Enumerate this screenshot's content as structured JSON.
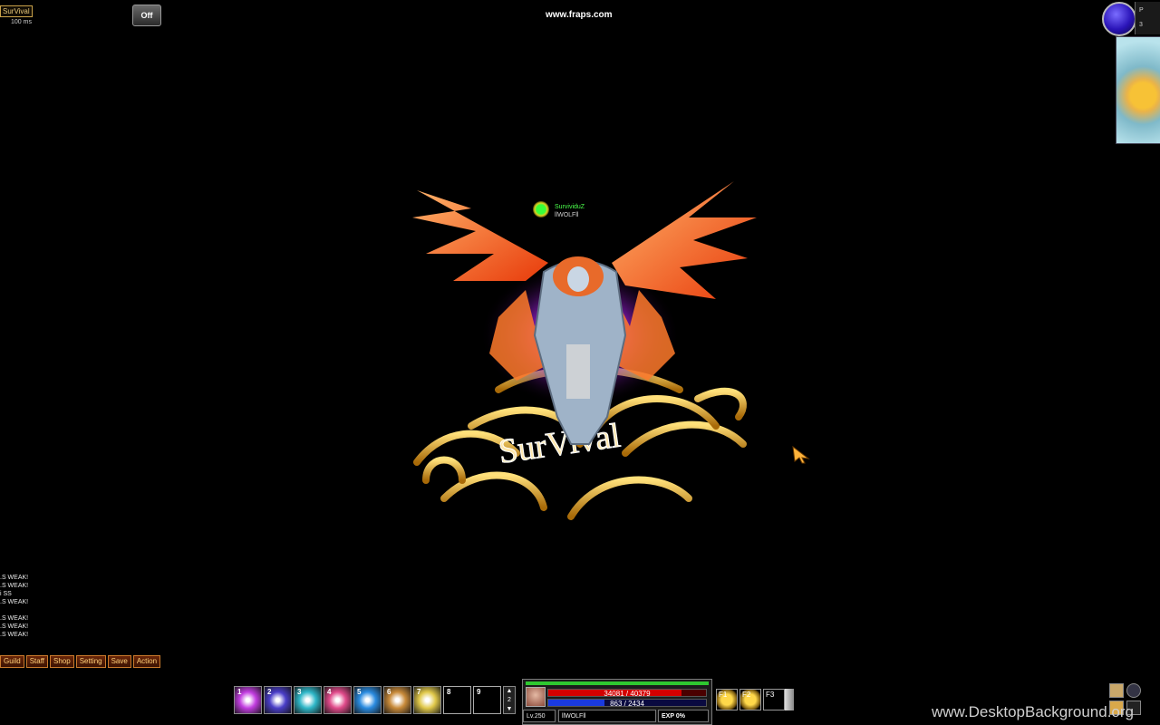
{
  "hud": {
    "server_label": "SurVival",
    "ping": "100 ms",
    "toggle_label": "Off",
    "recording_watermark": "www.fraps.com",
    "minimap_label_1": "P",
    "minimap_label_2": "3"
  },
  "character": {
    "guild_name": "SurvividuZ",
    "player_name": "llWOLFll",
    "ground_emblem_text": "SurVival"
  },
  "chat": {
    "lines": [
      ".S WEAK!",
      ".S WEAK!",
      "i SS",
      ".S WEAK!",
      "",
      ".S WEAK!",
      ".S WEAK!",
      ".S WEAK!"
    ]
  },
  "menu": {
    "buttons": [
      "Guild",
      "Staff",
      "Shop",
      "Setting",
      "Save",
      "Action"
    ]
  },
  "skill_bar": {
    "slots": [
      {
        "num": "1",
        "color": "#c23de0"
      },
      {
        "num": "2",
        "color": "#4a3ec8"
      },
      {
        "num": "3",
        "color": "#2fb7c8"
      },
      {
        "num": "4",
        "color": "#e04a8a"
      },
      {
        "num": "5",
        "color": "#2a8be0"
      },
      {
        "num": "6",
        "color": "#c88a3a"
      },
      {
        "num": "7",
        "color": "#e0c84a"
      },
      {
        "num": "8",
        "color": ""
      },
      {
        "num": "9",
        "color": ""
      }
    ],
    "page": "2"
  },
  "status": {
    "hp": "34081 / 40379",
    "hp_fraction": 0.844,
    "mp": "863 / 2434",
    "mp_fraction": 0.355,
    "level": "Lv.250",
    "name": "llWOLFll",
    "exp": "EXP 0%"
  },
  "function_keys": [
    "F1",
    "F2",
    "F3"
  ],
  "site_watermark": "www.DesktopBackground.org",
  "colors": {
    "hp": "#d40000",
    "mp": "#1a3ae0",
    "exp": "#2ec830",
    "menu_text": "#ffd27a"
  }
}
